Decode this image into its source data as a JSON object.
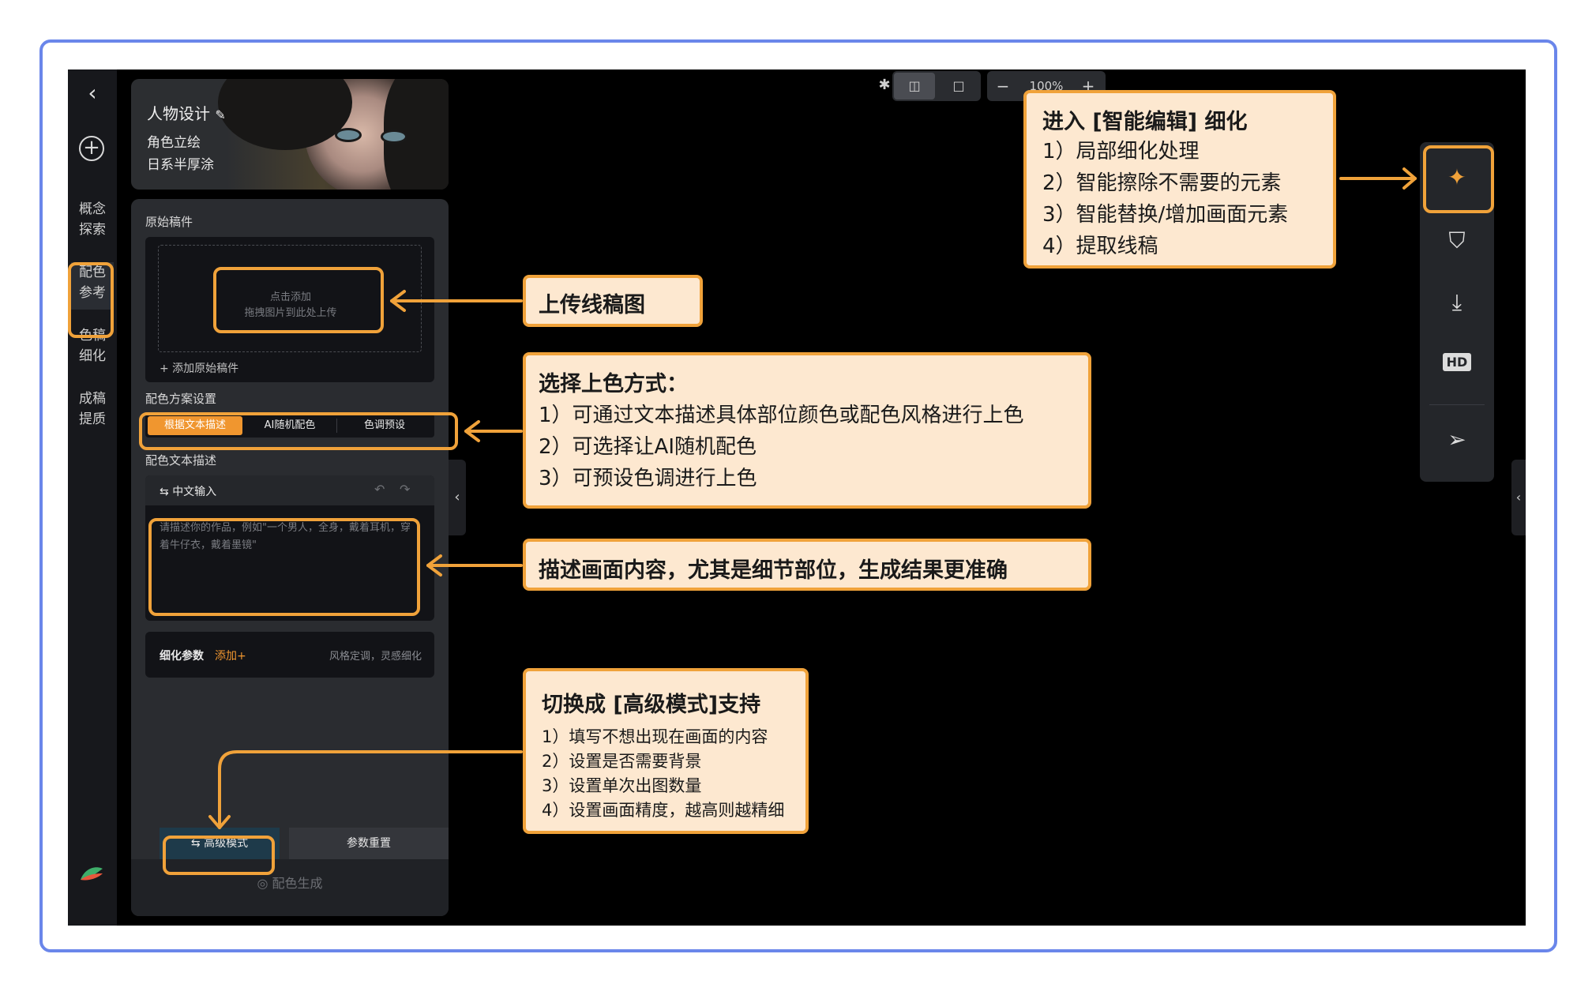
{
  "nav": {
    "items": [
      {
        "label_l1": "概念",
        "label_l2": "探索"
      },
      {
        "label_l1": "配色",
        "label_l2": "参考"
      },
      {
        "label_l1": "色稿",
        "label_l2": "细化"
      },
      {
        "label_l1": "成稿",
        "label_l2": "提质"
      }
    ]
  },
  "project": {
    "title": "人物设计",
    "subtitle1": "角色立绘",
    "subtitle2": "日系半厚涂"
  },
  "sketch": {
    "section_label": "原始稿件",
    "upload_line1": "点击添加",
    "upload_line2": "拖拽图片到此处上传",
    "add_label": "+ 添加原始稿件"
  },
  "scheme": {
    "section_label": "配色方案设置",
    "options": [
      "根据文本描述",
      "AI随机配色",
      "色调预设"
    ],
    "selected": "根据文本描述"
  },
  "description": {
    "section_label": "配色文本描述",
    "input_mode": "中文输入",
    "placeholder": "请描述你的作品，例如\"一个男人，全身，戴着耳机，穿着牛仔衣，戴着墨镜\""
  },
  "params": {
    "label": "细化参数",
    "add": "添加+",
    "hint": "风格定调，灵感细化"
  },
  "bottom": {
    "advanced": "高级模式",
    "reset": "参数重置",
    "generate": "配色生成"
  },
  "toolbar": {
    "zoom": "100%"
  },
  "callouts": {
    "upload": "上传线稿图",
    "coloring_title": "选择上色方式：",
    "coloring_lines": [
      "1）可通过文本描述具体部位颜色或配色风格进行上色",
      "2）可选择让AI随机配色",
      "3）可预设色调进行上色"
    ],
    "describe": "描述画面内容，尤其是细节部位，生成结果更准确",
    "advanced_title": "切换成 [高级模式]支持",
    "advanced_lines": [
      "1）填写不想出现在画面的内容",
      "2）设置是否需要背景",
      "3）设置单次出图数量",
      "4）设置画面精度，越高则越精细"
    ],
    "smart_title": "进入 [智能编辑] 细化",
    "smart_lines": [
      "1）局部细化处理",
      "2）智能擦除不需要的元素",
      "3）智能替换/增加画面元素",
      "4）提取线稿"
    ]
  },
  "colors": {
    "accent": "#f0a23a",
    "selected": "#f0962f",
    "callout_bg": "#fde8d0",
    "frame": "#6a86ea"
  }
}
